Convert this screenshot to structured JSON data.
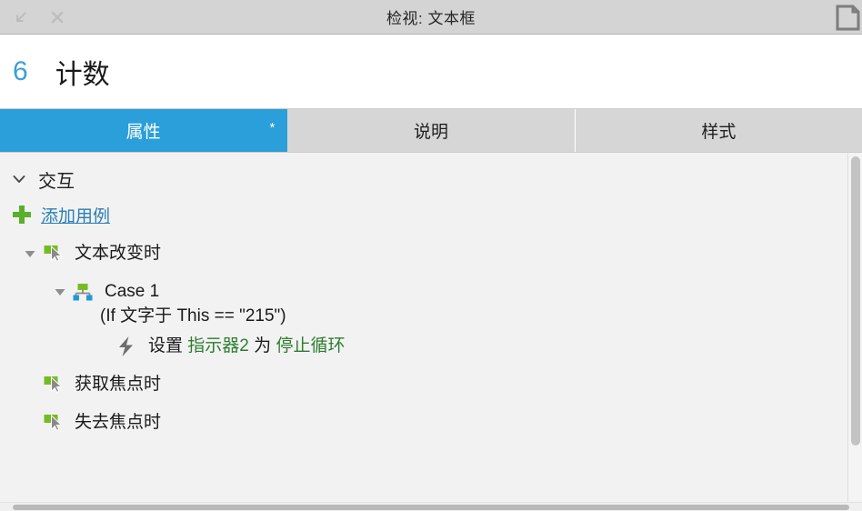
{
  "window": {
    "title": "检视: 文本框",
    "left_icons": [
      {
        "name": "dock-down-left-icon",
        "glyph": "arrow-down-left"
      },
      {
        "name": "close-icon",
        "glyph": "x"
      }
    ],
    "right_icon": {
      "name": "document-icon",
      "glyph": "page"
    }
  },
  "widget": {
    "number": "6",
    "name": "计数"
  },
  "tabs": [
    {
      "label": "属性",
      "active": true,
      "marker": "*"
    },
    {
      "label": "说明",
      "active": false,
      "marker": ""
    },
    {
      "label": "样式",
      "active": false,
      "marker": ""
    }
  ],
  "interactions": {
    "section_title": "交互",
    "add_case_label": "添加用例",
    "tree": {
      "event_text_changed": "文本改变时",
      "case_name": "Case 1",
      "case_condition": "(If 文字于 This == \"215\")",
      "action_prefix": "设置",
      "action_target": "指示器2",
      "action_joiner": "为",
      "action_value": "停止循环",
      "event_got_focus": "获取焦点时",
      "event_lost_focus": "失去焦点时"
    }
  },
  "colors": {
    "accent_blue": "#2b9fd9",
    "link_blue": "#2a7fb5",
    "number_blue": "#3aa0d8",
    "action_green": "#2d7d30",
    "icon_green": "#76bc21",
    "plus_green": "#5aaf2c",
    "icon_blue": "#1c9ad6",
    "titlebar_gray": "#d4d4d4",
    "content_gray": "#f2f2f2"
  }
}
